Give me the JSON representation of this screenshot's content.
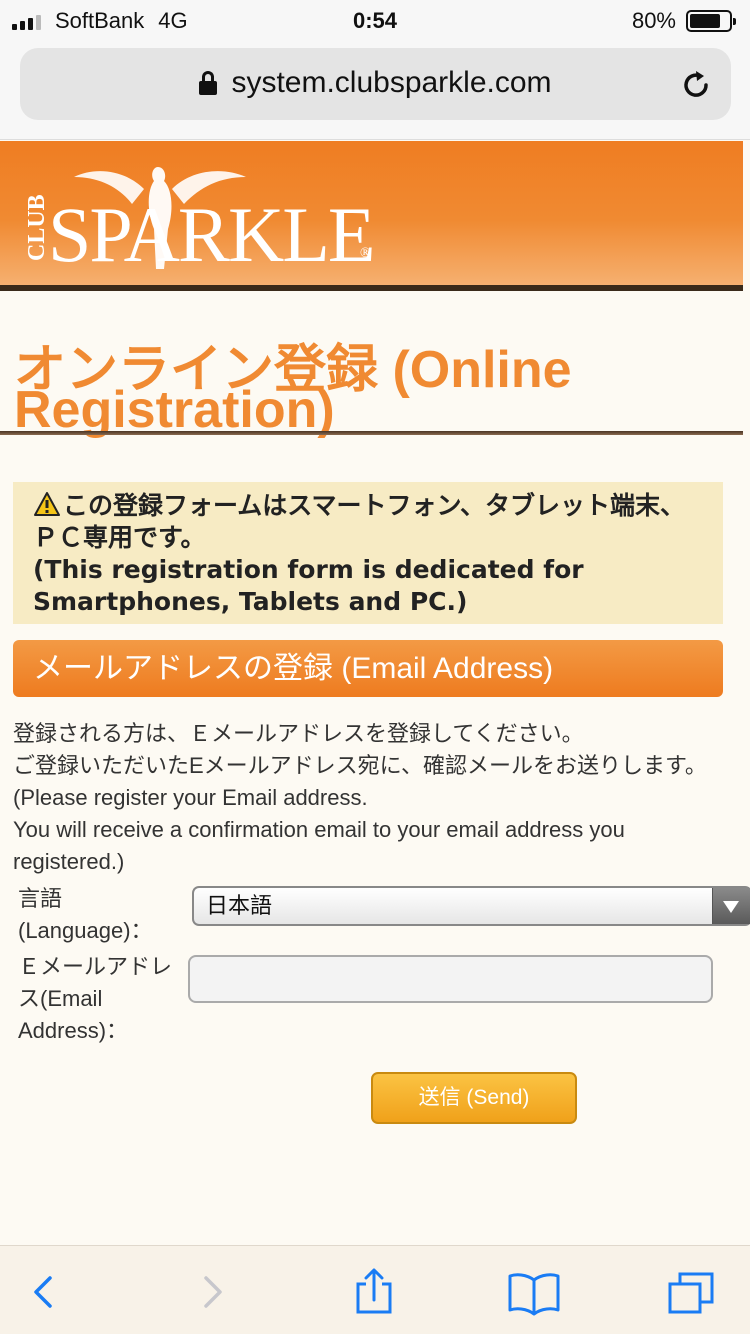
{
  "status_bar": {
    "carrier": "SoftBank",
    "network": "4G",
    "time": "0:54",
    "battery": "80%",
    "battery_level": 0.8
  },
  "browser": {
    "url": "system.clubsparkle.com",
    "icons": [
      "lock-icon",
      "reload-icon"
    ]
  },
  "header": {
    "logo_prefix": "CLUB",
    "logo_text": "SPARKLE",
    "logo_mark": "®"
  },
  "page": {
    "title": "オンライン登録 (Online Registration)",
    "notice_jp": "この登録フォームはスマートフォン、タブレット端末、ＰＣ専用です。",
    "notice_en": "(This registration form is dedicated for Smartphones, Tablets and PC.)",
    "section_title": "メールアドレスの登録 (Email Address)",
    "desc_jp_1": "登録される方は、Ｅメールアドレスを登録してください。",
    "desc_jp_2": "ご登録いただいたEメールアドレス宛に、確認メールをお送りします。",
    "desc_en_1": "(Please register your Email address.",
    "desc_en_2": "You will receive a confirmation email to your email address you registered.)"
  },
  "form": {
    "language_label_1": "言語",
    "language_label_2": "(Language)：",
    "language_value": "日本語",
    "email_label_1": "Ｅメールアドレ",
    "email_label_2": "ス(Email",
    "email_label_3": "Address)：",
    "email_value": "",
    "send_label": "送信 (Send)"
  },
  "toolbar": {
    "icons": [
      "back-icon",
      "forward-icon",
      "share-icon",
      "bookmarks-icon",
      "tabs-icon"
    ]
  },
  "colors": {
    "accent": "#ef7d22",
    "ios_blue": "#1a7cf4",
    "notice_bg": "#f7ebc4",
    "send_button": "#f0a11a"
  }
}
